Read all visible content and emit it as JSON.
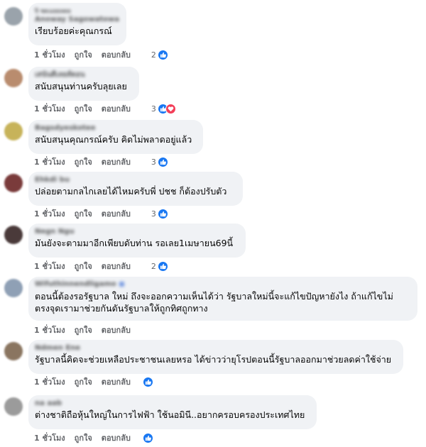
{
  "comments": [
    {
      "name": "ปิ ชดเมยยลดย",
      "subname": "Anoway Sagowatowa",
      "text": "เรียบร้อยค่ะคุณกรณ์",
      "time": "1 ชั่วโมง",
      "like": "ถูกใจ",
      "reply": "ตอบกลับ",
      "count": "2",
      "reactions": [
        "like"
      ],
      "avatar": "#9aa3ab"
    },
    {
      "name": "เสนันดีเลยส์ดอน",
      "text": "สนับสนุนท่านครับลุยเลย",
      "time": "1 ชั่วโมง",
      "like": "ถูกใจ",
      "reply": "ตอบกลับ",
      "count": "3",
      "reactions": [
        "like",
        "love"
      ],
      "avatar": "#b98c6e"
    },
    {
      "name": "Bagsdyeskotee",
      "text": "สนับสนุนคุณกรณ์ครับ คิดไม่พลาดอยู่แล้ว",
      "time": "1 ชั่วโมง",
      "like": "ถูกใจ",
      "reply": "ตอบกลับ",
      "count": "3",
      "reactions": [
        "like"
      ],
      "avatar": "#c7b35a"
    },
    {
      "name": "Ehkdi bu",
      "text": "ปล่อยตามกลไกเลยได้ไหมครับพี่ ปชช ก็ต้องปรับตัว",
      "time": "1 ชั่วโมง",
      "like": "ถูกใจ",
      "reply": "ตอบกลับ",
      "count": "3",
      "reactions": [
        "like"
      ],
      "avatar": "#7a3b3b"
    },
    {
      "name": "Negn Ngu",
      "text": "มันยังจะตามมาอีกเพียบดับท่าน รอเลย1เมษายน69นี้",
      "time": "1 ชั่วโมง",
      "like": "ถูกใจ",
      "reply": "ตอบกลับ",
      "count": "2",
      "reactions": [
        "like"
      ],
      "avatar": "#4a3a3a"
    },
    {
      "name": "Wifuthinnendligamo",
      "text1": "ตอนนี้ต้องรอรัฐบาล ใหม่ ถึงจะออกความเห็นได้ว่า รัฐบาลใหม่นี้จะแก้ไขปัญหายังไง ถ้าแก้ไขไม่",
      "text2": "ตรงจุดเรามาช่วยกันดันรัฐบาลให้ถูกทิศถูกทาง",
      "time": "1 ชั่วโมง",
      "like": "ถูกใจ",
      "reply": "ตอบกลับ",
      "avatar": "#8fa0b5"
    },
    {
      "name": "Ndmen Ene",
      "text": "รัฐบาลนี้คิดจะช่วยเหลือประชาชนเลยหรอ ได้ข่าวว่ายุโรปตอนนี้รัฐบาลออกมาช่วยลดค่าใช้จ่าย",
      "time": "1 ชั่วโมง",
      "like": "ถูกใจ",
      "reply": "ตอบกลับ",
      "reactions": [
        "like"
      ],
      "avatar": "#8a7560"
    },
    {
      "name": "na aab",
      "text": "ต่างชาติถือหุ้นใหญ่ในการไฟฟ้า ใช้นอมินี..อยากครอบครองประเทศไทย",
      "time": "1 ชั่วโมง",
      "like": "ถูกใจ",
      "reply": "ตอบกลับ",
      "reactions": [
        "like"
      ],
      "avatar": "#9b9b9b"
    }
  ]
}
